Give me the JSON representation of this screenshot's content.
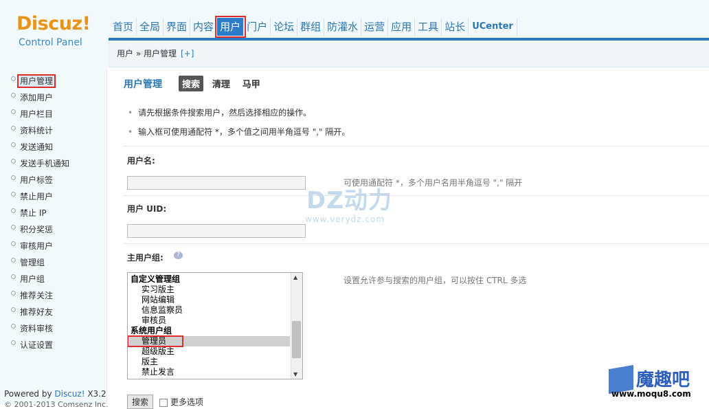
{
  "logo": {
    "brand": "Discuz!",
    "subtitle": "Control Panel"
  },
  "nav": {
    "items": [
      "首页",
      "全局",
      "界面",
      "内容",
      "用户",
      "门户",
      "论坛",
      "群组",
      "防灌水",
      "运营",
      "应用",
      "工具",
      "站长",
      "UCenter"
    ],
    "active_index": 4
  },
  "breadcrumb": {
    "text": "用户 » 用户管理",
    "add_label": "[+]"
  },
  "sidebar": {
    "items": [
      "用户管理",
      "添加用户",
      "用户栏目",
      "资料统计",
      "发送通知",
      "发送手机通知",
      "用户标签",
      "禁止用户",
      "禁止 IP",
      "积分奖惩",
      "审核用户",
      "管理组",
      "用户组",
      "推荐关注",
      "推荐好友",
      "资料审核",
      "认证设置"
    ],
    "active_index": 0,
    "powered_prefix": "Powered by ",
    "powered_brand": "Discuz!",
    "powered_version": " X3.2",
    "copyright": "© 2001-2013 Comsenz Inc."
  },
  "main": {
    "title": "用户管理",
    "tabs": [
      "搜索",
      "清理",
      "马甲"
    ],
    "current_tab": 0,
    "tips": [
      "请先根据条件搜索用户，然后选择相应的操作。",
      "输入框可使用通配符 *，多个值之间用半角逗号 \",\" 隔开。"
    ],
    "username_label": "用户名:",
    "username_value": "",
    "username_hint": "可使用通配符 *，多个用户名用半角逗号 \",\" 隔开",
    "uid_label": "用户 UID:",
    "uid_value": "",
    "group_label": "主用户组:",
    "group_hint": "设置允许参与搜索的用户组，可以按住 CTRL 多选",
    "group_options": [
      {
        "label": "自定义管理组",
        "group": true
      },
      {
        "label": "实习版主"
      },
      {
        "label": "网站编辑"
      },
      {
        "label": "信息监察员"
      },
      {
        "label": "审核员"
      },
      {
        "label": "系统用户组",
        "group": true
      },
      {
        "label": "管理员",
        "selected": true
      },
      {
        "label": "超级版主"
      },
      {
        "label": "版主"
      },
      {
        "label": "禁止发言"
      }
    ],
    "search_button": "搜索",
    "more_options": "更多选项"
  },
  "watermarks": {
    "dz": "DZ动力",
    "dz_url": "www.verydz.com",
    "moqu": "魔趣吧",
    "moqu_url": "www.moqu8.com"
  },
  "colors": {
    "accent": "#2b7bc9",
    "highlight": "#e12b2b",
    "logo": "#e8941a"
  }
}
